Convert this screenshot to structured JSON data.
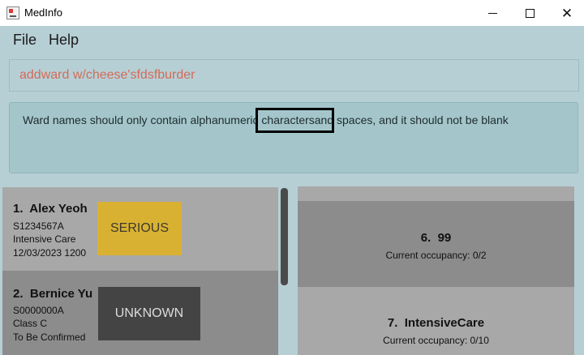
{
  "window": {
    "title": "MedInfo",
    "app_icon": "medinfo-app-icon",
    "controls": {
      "minimize": "minimize-icon",
      "maximize": "maximize-icon",
      "close": "close-icon",
      "close_glyph": "✕"
    }
  },
  "menu": {
    "file": "File",
    "help": "Help"
  },
  "command_box": {
    "value": "addward w/cheese'sfdsfburder",
    "text_color": "#d26b5a"
  },
  "result_display": {
    "message": "Ward names should only contain alphanumeric charactersand spaces, and it should not be blank",
    "highlighted_word": "charactersand"
  },
  "patients": [
    {
      "index": "1.",
      "name": "Alex Yeoh",
      "nric": "S1234567A",
      "ward": "Intensive Care",
      "discharge": "12/03/2023 1200",
      "status": "SERIOUS",
      "status_color": "#d9b132"
    },
    {
      "index": "2.",
      "name": "Bernice Yu",
      "nric": "S0000000A",
      "ward": "Class C",
      "discharge": "To Be Confirmed",
      "status": "UNKNOWN",
      "status_color": "#444444"
    }
  ],
  "wards": [
    {
      "index": "6.",
      "name": "99",
      "occupancy": "Current occupancy: 0/2"
    },
    {
      "index": "7.",
      "name": "IntensiveCare",
      "occupancy": "Current occupancy: 0/10"
    }
  ]
}
